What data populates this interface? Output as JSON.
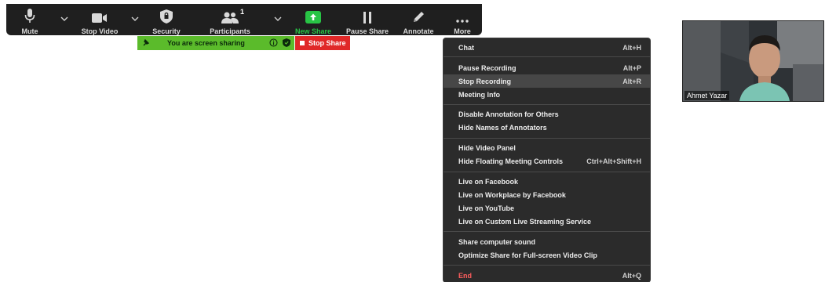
{
  "toolbar": {
    "mute_label": "Mute",
    "stop_video_label": "Stop Video",
    "security_label": "Security",
    "participants_label": "Participants",
    "participants_count": "1",
    "new_share_label": "New Share",
    "pause_share_label": "Pause Share",
    "annotate_label": "Annotate",
    "more_label": "More"
  },
  "sharebar": {
    "status_text": "You are screen sharing",
    "stop_share_label": "Stop Share"
  },
  "menu": {
    "items": [
      {
        "label": "Chat",
        "shortcut": "Alt+H"
      },
      {
        "label": "Pause Recording",
        "shortcut": "Alt+P"
      },
      {
        "label": "Stop Recording",
        "shortcut": "Alt+R"
      },
      {
        "label": "Meeting Info",
        "shortcut": ""
      },
      {
        "label": "Disable Annotation for Others",
        "shortcut": ""
      },
      {
        "label": "Hide Names of Annotators",
        "shortcut": ""
      },
      {
        "label": "Hide Video Panel",
        "shortcut": ""
      },
      {
        "label": "Hide Floating Meeting Controls",
        "shortcut": "Ctrl+Alt+Shift+H"
      },
      {
        "label": "Live on Facebook",
        "shortcut": ""
      },
      {
        "label": "Live on Workplace by Facebook",
        "shortcut": ""
      },
      {
        "label": "Live on YouTube",
        "shortcut": ""
      },
      {
        "label": "Live on Custom Live Streaming Service",
        "shortcut": ""
      },
      {
        "label": "Share computer sound",
        "shortcut": ""
      },
      {
        "label": "Optimize Share for Full-screen Video Clip",
        "shortcut": ""
      },
      {
        "label": "End",
        "shortcut": "Alt+Q"
      }
    ]
  },
  "video": {
    "participant_name": "Ahmet Yazar"
  },
  "colors": {
    "toolbar_bg": "#1f1f1f",
    "share_green": "#28c445",
    "sharing_bar_green": "#5bbb2b",
    "stop_red": "#e02828",
    "menu_bg": "#2b2b2b",
    "end_red": "#ff5d5d"
  }
}
